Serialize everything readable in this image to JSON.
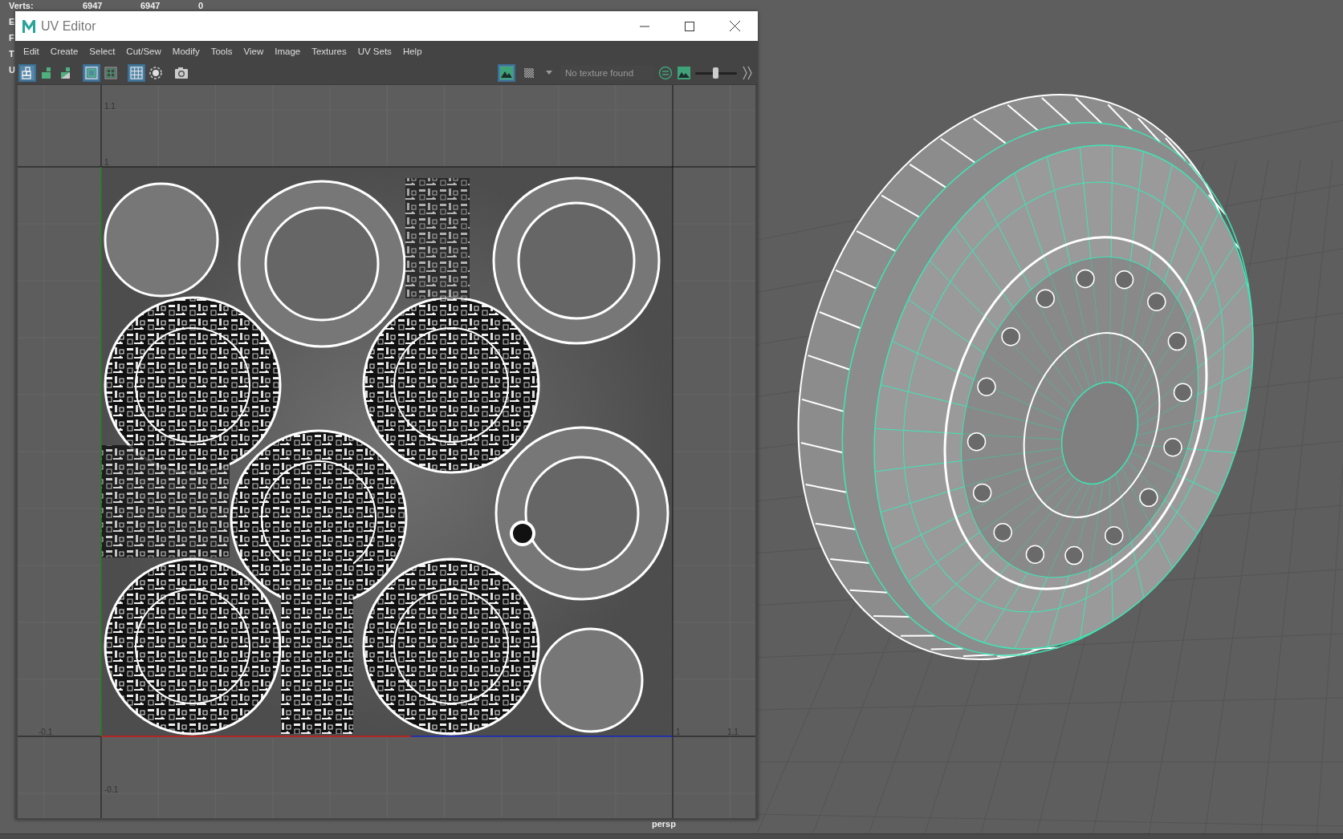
{
  "hud": {
    "verts": {
      "label": "Verts:",
      "values": [
        "6947",
        "6947",
        "0"
      ]
    },
    "cut_labels": [
      "E",
      "F",
      "T",
      "U"
    ]
  },
  "uv_editor": {
    "title": "UV Editor",
    "menu": [
      "Edit",
      "Create",
      "Select",
      "Cut/Sew",
      "Modify",
      "Tools",
      "View",
      "Image",
      "Textures",
      "UV Sets",
      "Help"
    ],
    "toolbar": {
      "groups": [
        [
          {
            "kind": "shell",
            "selected": true
          },
          {
            "kind": "blocks",
            "selected": false
          },
          {
            "kind": "blocks-shaded",
            "selected": false
          }
        ],
        [
          {
            "kind": "frame",
            "selected": true
          },
          {
            "kind": "frame-cross",
            "selected": false
          }
        ],
        [
          {
            "kind": "grid",
            "selected": true
          },
          {
            "kind": "dotted-circle",
            "selected": false
          }
        ],
        [
          {
            "kind": "camera",
            "selected": false
          }
        ]
      ],
      "image_toggle": {
        "selected": true
      },
      "checker_toggle": {
        "selected": false
      },
      "texture_menu": {
        "value": "No texture found"
      },
      "exposure_slider": {
        "level": 0.5
      }
    },
    "grid_labels": [
      "1.1",
      "1",
      "-0.1",
      "1",
      "1.1",
      "-0.1"
    ]
  },
  "viewport": {
    "camera": "persp"
  }
}
